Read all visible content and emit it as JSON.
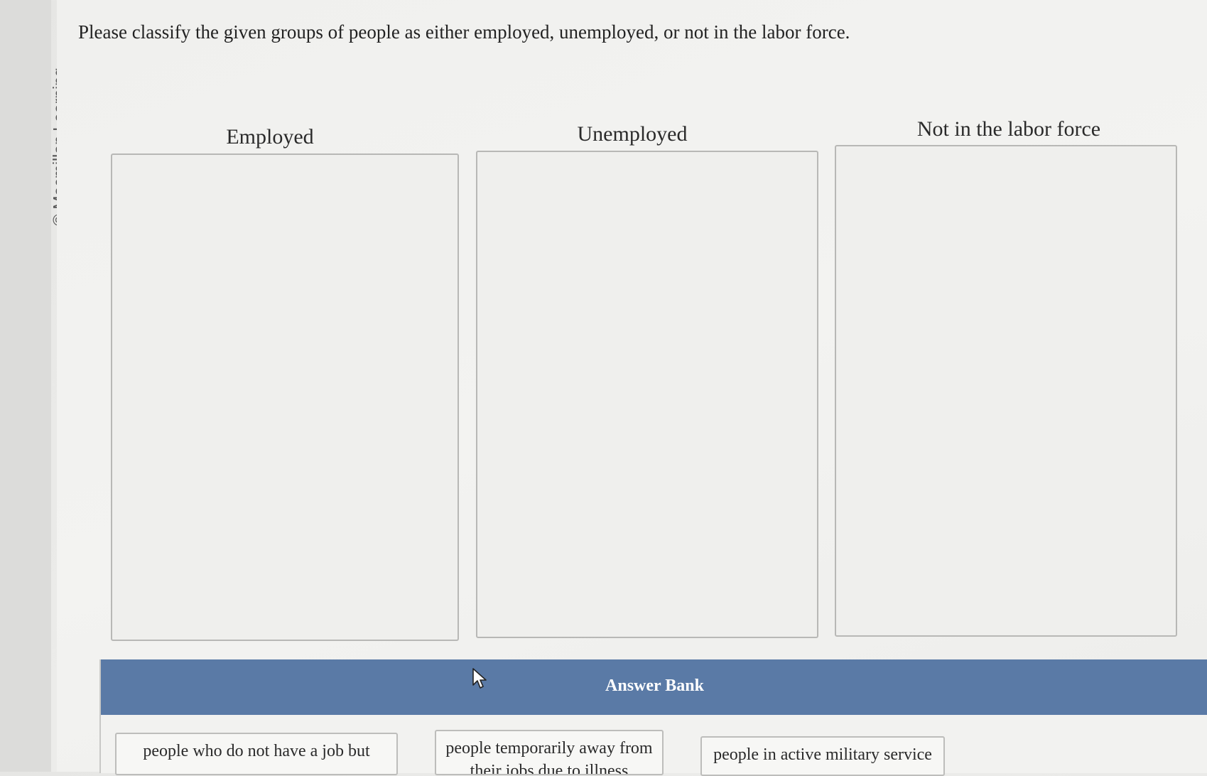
{
  "copyright": "© Macmillan Learning",
  "question": "Please classify the given groups of people as either employed, unemployed, or not in the labor force.",
  "categories": [
    {
      "label": "Employed"
    },
    {
      "label": "Unemployed"
    },
    {
      "label": "Not in the labor force"
    }
  ],
  "answer_bank": {
    "title": "Answer Bank",
    "items": [
      {
        "line1": "people who do not have a job but",
        "line2": ""
      },
      {
        "line1": "people temporarily away from",
        "line2": "their jobs due to illness"
      },
      {
        "line1": "people in active military service",
        "line2": ""
      }
    ]
  },
  "colors": {
    "bank_header": "#5a7aa6",
    "zone_border": "#b8b8b6"
  }
}
